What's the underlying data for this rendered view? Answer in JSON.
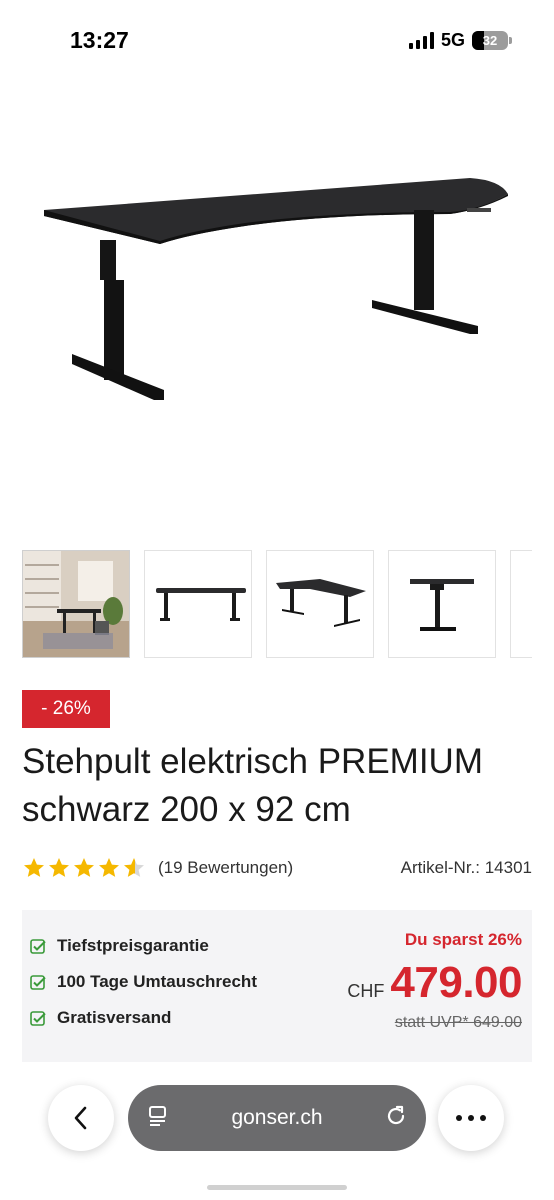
{
  "status_bar": {
    "time": "13:27",
    "network": "5G",
    "battery_level": "32",
    "icons": [
      "signal-icon",
      "battery-icon"
    ]
  },
  "product": {
    "discount_badge": "- 26%",
    "title": "Stehpult elektrisch PREMIUM schwarz 200 x 92 cm",
    "rating_stars": 4.5,
    "rating_count_text": "(19 Bewertungen)",
    "article_number": "Artikel-Nr.: 14301",
    "thumbnails": [
      "room-scene",
      "front-view",
      "angled-view",
      "side-view",
      "more"
    ]
  },
  "price_box": {
    "features": [
      "Tiefstpreisgarantie",
      "100 Tage Umtauschrecht",
      "Gratisversand"
    ],
    "savings": "Du sparst 26%",
    "currency": "CHF",
    "price": "479.00",
    "old_price": "statt UVP* 649.00"
  },
  "browser": {
    "url": "gonser.ch",
    "icons": [
      "back-icon",
      "reader-icon",
      "reload-icon",
      "more-icon"
    ]
  },
  "colors": {
    "accent_red": "#d5262e",
    "check_green": "#3a9a3a",
    "star_yellow": "#f5b800",
    "address_bar_gray": "#6b6b6d"
  }
}
